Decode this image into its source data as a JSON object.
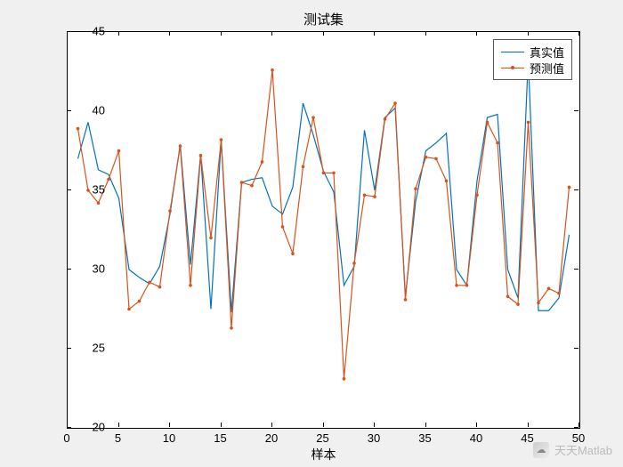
{
  "chart_data": {
    "type": "line",
    "title": "测试集",
    "xlabel": "样本",
    "ylabel": "",
    "xlim": [
      0,
      50
    ],
    "ylim": [
      20,
      45
    ],
    "xticks": [
      0,
      5,
      10,
      15,
      20,
      25,
      30,
      35,
      40,
      45,
      50
    ],
    "yticks": [
      20,
      25,
      30,
      35,
      40,
      45
    ],
    "legend_position": "northeast",
    "x": [
      1,
      2,
      3,
      4,
      5,
      6,
      7,
      8,
      9,
      10,
      11,
      12,
      13,
      14,
      15,
      16,
      17,
      18,
      19,
      20,
      21,
      22,
      23,
      24,
      25,
      26,
      27,
      28,
      29,
      30,
      31,
      32,
      33,
      34,
      35,
      36,
      37,
      38,
      39,
      40,
      41,
      42,
      43,
      44,
      45,
      46,
      47,
      48,
      49
    ],
    "series": [
      {
        "name": "真实值",
        "color": "#0072BD",
        "marker": false,
        "values": [
          37.0,
          39.3,
          36.3,
          36.0,
          34.5,
          30.0,
          29.5,
          29.1,
          30.2,
          33.5,
          37.9,
          30.3,
          37.3,
          27.5,
          38.2,
          27.3,
          35.5,
          35.7,
          35.8,
          34.0,
          33.5,
          35.2,
          40.5,
          38.5,
          36.2,
          34.9,
          29.0,
          30.2,
          38.8,
          35.0,
          39.6,
          40.2,
          28.3,
          34.3,
          37.5,
          38.0,
          38.6,
          30.0,
          29.0,
          35.6,
          39.6,
          39.8,
          30.0,
          28.2,
          43.3,
          27.4,
          27.4,
          28.2,
          32.2
        ]
      },
      {
        "name": "预测值",
        "color": "#D95319",
        "marker": true,
        "values": [
          38.9,
          35.0,
          34.2,
          35.7,
          37.5,
          27.5,
          28.0,
          29.2,
          28.9,
          33.7,
          37.8,
          29.0,
          37.2,
          32.0,
          38.2,
          26.3,
          35.5,
          35.3,
          36.8,
          42.6,
          32.7,
          31.0,
          36.5,
          39.6,
          36.1,
          36.1,
          23.1,
          30.4,
          34.7,
          34.6,
          39.5,
          40.5,
          28.1,
          35.1,
          37.1,
          37.0,
          35.6,
          29.0,
          29.0,
          34.7,
          39.3,
          38.0,
          28.3,
          27.8,
          39.3,
          27.9,
          28.8,
          28.5,
          35.2
        ]
      }
    ]
  },
  "legend": {
    "items": [
      "真实值",
      "预测值"
    ]
  },
  "watermark": {
    "icon": "☁",
    "text": "天天Matlab"
  }
}
